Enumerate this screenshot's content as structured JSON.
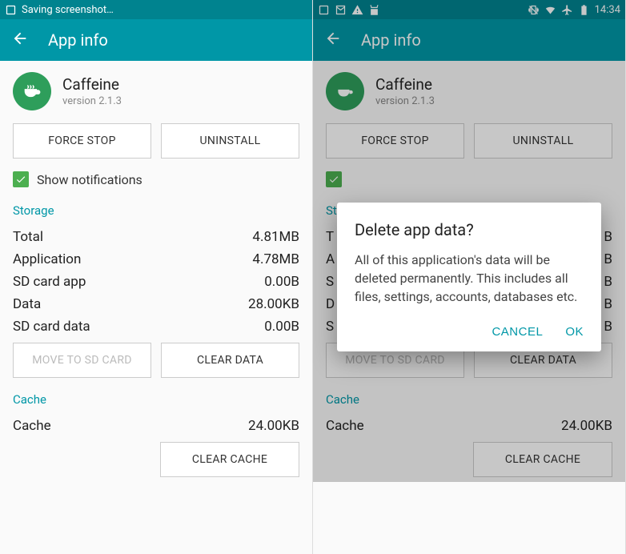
{
  "left": {
    "status_text": "Saving screenshot…",
    "appbar_title": "App info",
    "app_name": "Caffeine",
    "app_version": "version 2.1.3",
    "force_stop": "FORCE STOP",
    "uninstall": "UNINSTALL",
    "show_notifications": "Show notifications",
    "storage_title": "Storage",
    "rows": {
      "total_label": "Total",
      "total_value": "4.81MB",
      "application_label": "Application",
      "application_value": "4.78MB",
      "sd_app_label": "SD card app",
      "sd_app_value": "0.00B",
      "data_label": "Data",
      "data_value": "28.00KB",
      "sd_data_label": "SD card data",
      "sd_data_value": "0.00B"
    },
    "move_to_sd": "MOVE TO SD CARD",
    "clear_data": "CLEAR DATA",
    "cache_title": "Cache",
    "cache_label": "Cache",
    "cache_value": "24.00KB",
    "clear_cache": "CLEAR CACHE"
  },
  "right": {
    "clock": "14:34",
    "appbar_title": "App info",
    "app_name": "Caffeine",
    "app_version": "version 2.1.3",
    "force_stop": "FORCE STOP",
    "uninstall": "UNINSTALL",
    "storage_title": "St",
    "rows": {
      "r1l": "T",
      "r1v": "B",
      "r2l": "A",
      "r2v": "B",
      "r3l": "S",
      "r3v": "B",
      "r4l": "D",
      "r4v": "B",
      "r5l": "S",
      "r5v": "B"
    },
    "move_to_sd": "MOVE TO SD CARD",
    "clear_data": "CLEAR DATA",
    "cache_title": "Cache",
    "cache_label": "Cache",
    "cache_value": "24.00KB",
    "clear_cache": "CLEAR CACHE",
    "dialog": {
      "title": "Delete app data?",
      "body": "All of this application's data will be deleted permanently. This includes all files, settings, accounts, databases etc.",
      "cancel": "CANCEL",
      "ok": "OK"
    }
  }
}
